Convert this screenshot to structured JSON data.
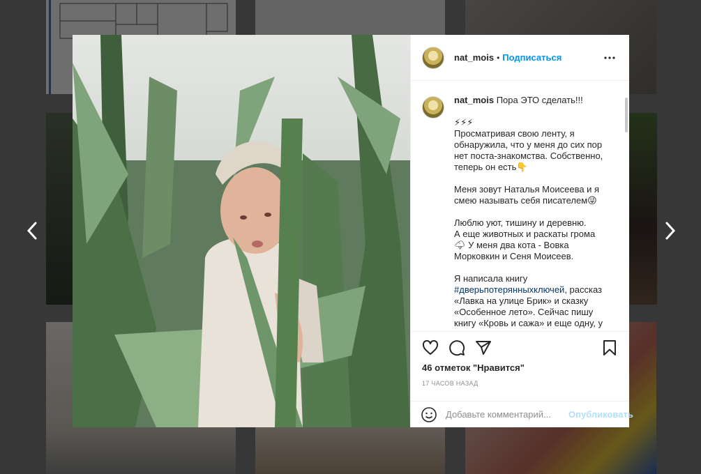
{
  "post": {
    "username": "nat_mois",
    "dot": "•",
    "follow_label": "Подписаться",
    "caption": {
      "username": "nat_mois",
      "title": "Пора ЭТО сделать!!!",
      "lines": [
        "⚡⚡⚡",
        "Просматривая свою ленту, я",
        "обнаружила, что у меня до сих пор",
        "нет поста-знакомства. Собственно,",
        "теперь он есть👇",
        "",
        "Меня зовут Наталья Моисеева и я",
        "смею называть себя писателем😜",
        "",
        "Люблю уют, тишину и деревню.",
        "А еще животных и раскаты грома",
        "🌩 У меня два кота - Вовка",
        "Моркoвкин и Сеня Моисеев.",
        "",
        "Я написала книгу"
      ],
      "hashtag": "#дверьпотерянныхключей",
      "hashtag_tail": ", рассказ",
      "after_lines": [
        "«Лавка на улице Брик» и сказку",
        "«Особенное лето». Сейчас пишу",
        "книгу «Кровь и сажа» и еще одну, у"
      ]
    },
    "likes": "46 отметок \"Нравится\"",
    "time": "17 часов назад",
    "comment_placeholder": "Добавьте комментарий...",
    "publish_label": "Опубликовать"
  },
  "icons": {
    "prev": "chevron-left-icon",
    "next": "chevron-right-icon",
    "more": "more-icon",
    "like": "heart-icon",
    "comment": "comment-icon",
    "share": "share-icon",
    "save": "bookmark-icon",
    "emoji": "emoji-icon"
  },
  "colors": {
    "accent": "#0095f6",
    "publish_disabled": "#b2dffc",
    "hashtag": "#00376b"
  }
}
